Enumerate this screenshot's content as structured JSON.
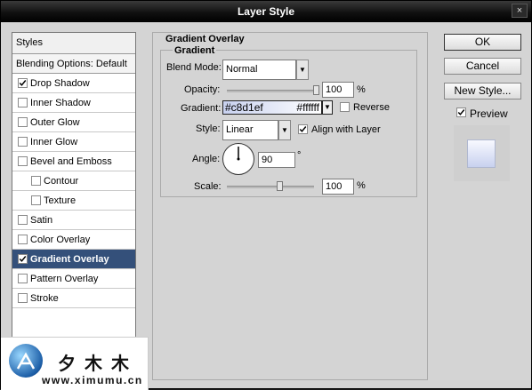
{
  "window": {
    "title": "Layer Style",
    "close_symbol": "×"
  },
  "styles_panel": {
    "header": "Styles",
    "blending_options": "Blending Options: Default",
    "items": [
      {
        "label": "Drop Shadow",
        "checked": true,
        "indent": false,
        "selected": false
      },
      {
        "label": "Inner Shadow",
        "checked": false,
        "indent": false,
        "selected": false
      },
      {
        "label": "Outer Glow",
        "checked": false,
        "indent": false,
        "selected": false
      },
      {
        "label": "Inner Glow",
        "checked": false,
        "indent": false,
        "selected": false
      },
      {
        "label": "Bevel and Emboss",
        "checked": false,
        "indent": false,
        "selected": false
      },
      {
        "label": "Contour",
        "checked": false,
        "indent": true,
        "selected": false
      },
      {
        "label": "Texture",
        "checked": false,
        "indent": true,
        "selected": false
      },
      {
        "label": "Satin",
        "checked": false,
        "indent": false,
        "selected": false
      },
      {
        "label": "Color Overlay",
        "checked": false,
        "indent": false,
        "selected": false
      },
      {
        "label": "Gradient Overlay",
        "checked": true,
        "indent": false,
        "selected": true
      },
      {
        "label": "Pattern Overlay",
        "checked": false,
        "indent": false,
        "selected": false
      },
      {
        "label": "Stroke",
        "checked": false,
        "indent": false,
        "selected": false
      }
    ]
  },
  "gradient_overlay": {
    "group_title": "Gradient Overlay",
    "subgroup_title": "Gradient",
    "blend_mode": {
      "label": "Blend Mode:",
      "value": "Normal"
    },
    "opacity": {
      "label": "Opacity:",
      "value": "100",
      "unit": "%",
      "level": 1.0
    },
    "gradient": {
      "label": "Gradient:",
      "start_color": "#c8d1ef",
      "end_color": "#ffffff"
    },
    "reverse": {
      "label": "Reverse",
      "checked": false
    },
    "style": {
      "label": "Style:",
      "value": "Linear"
    },
    "align_with_layer": {
      "label": "Align with Layer",
      "checked": true
    },
    "angle": {
      "label": "Angle:",
      "value": "90",
      "unit": "°"
    },
    "scale": {
      "label": "Scale:",
      "value": "100",
      "unit": "%",
      "level": 0.6
    }
  },
  "buttons": {
    "ok": "OK",
    "cancel": "Cancel",
    "new_style": "New Style..."
  },
  "preview": {
    "label": "Preview",
    "checked": true
  },
  "colors": {
    "selected_row": "#34507a",
    "gradient_start": "#c8d1ef",
    "gradient_end": "#ffffff"
  },
  "watermark": {
    "site_name": "夕木木",
    "url": "www.ximumu.cn",
    "logo_icon": "ximumu-logo"
  }
}
